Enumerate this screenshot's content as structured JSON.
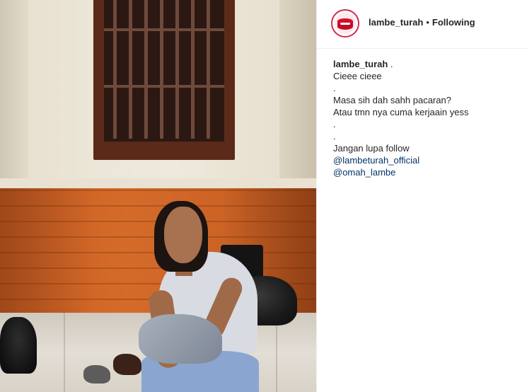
{
  "header": {
    "username": "lambe_turah",
    "separator": "•",
    "follow_status": "Following"
  },
  "caption": {
    "username": "lambe_turah",
    "username_suffix": " .",
    "lines": [
      "Cieee cieee",
      ".",
      "Masa sih dah sahh pacaran?",
      "Atau tmn nya cuma kerjaain yess",
      ".",
      ".",
      "Jangan lupa follow"
    ],
    "mentions": [
      "@lambeturah_official",
      "@omah_lambe"
    ]
  },
  "colors": {
    "link": "#003569",
    "text": "#262626",
    "avatar_ring": "#d02b55"
  }
}
